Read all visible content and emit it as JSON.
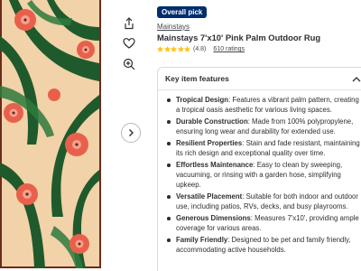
{
  "colors": {
    "badge_bg": "#002e6d",
    "star": "#ffc220",
    "rug_background": "#f2d2a8",
    "palm_green": "#1f5a2c",
    "hibiscus_red": "#e8604c",
    "border_stripe": "#7a2e22"
  },
  "actions": {
    "share_icon": "share-icon",
    "favorite_icon": "heart-icon",
    "zoom_icon": "zoom-in-icon",
    "next_icon": "chevron-right-icon"
  },
  "product": {
    "badge": "Overall pick",
    "brand": "Mainstays",
    "title": "Mainstays 7'x10' Pink Palm Outdoor Rug",
    "rating_value": 4.8,
    "rating_display": "(4.8)",
    "rating_count": "610 ratings"
  },
  "features": {
    "title": "Key item features",
    "items": [
      {
        "label": "Tropical Design",
        "text": ": Features a vibrant palm pattern, creating a tropical oasis aesthetic for various living spaces."
      },
      {
        "label": "Durable Construction",
        "text": ": Made from 100% polypropylene, ensuring long wear and durability for extended use."
      },
      {
        "label": "Resilient Properties",
        "text": ": Stain and fade resistant, maintaining its rich design and exceptional quality over time."
      },
      {
        "label": "Effortless Maintenance",
        "text": ": Easy to clean by sweeping, vacuuming, or rinsing with a garden hose, simplifying upkeep."
      },
      {
        "label": "Versatile Placement",
        "text": ": Suitable for both indoor and outdoor use, including patios, RVs, decks, and busy playrooms."
      },
      {
        "label": "Generous Dimensions",
        "text": ": Measures 7'x10', providing ample coverage for various areas."
      },
      {
        "label": "Family Friendly",
        "text": ": Designed to be pet and family friendly, accommodating active households."
      }
    ]
  }
}
